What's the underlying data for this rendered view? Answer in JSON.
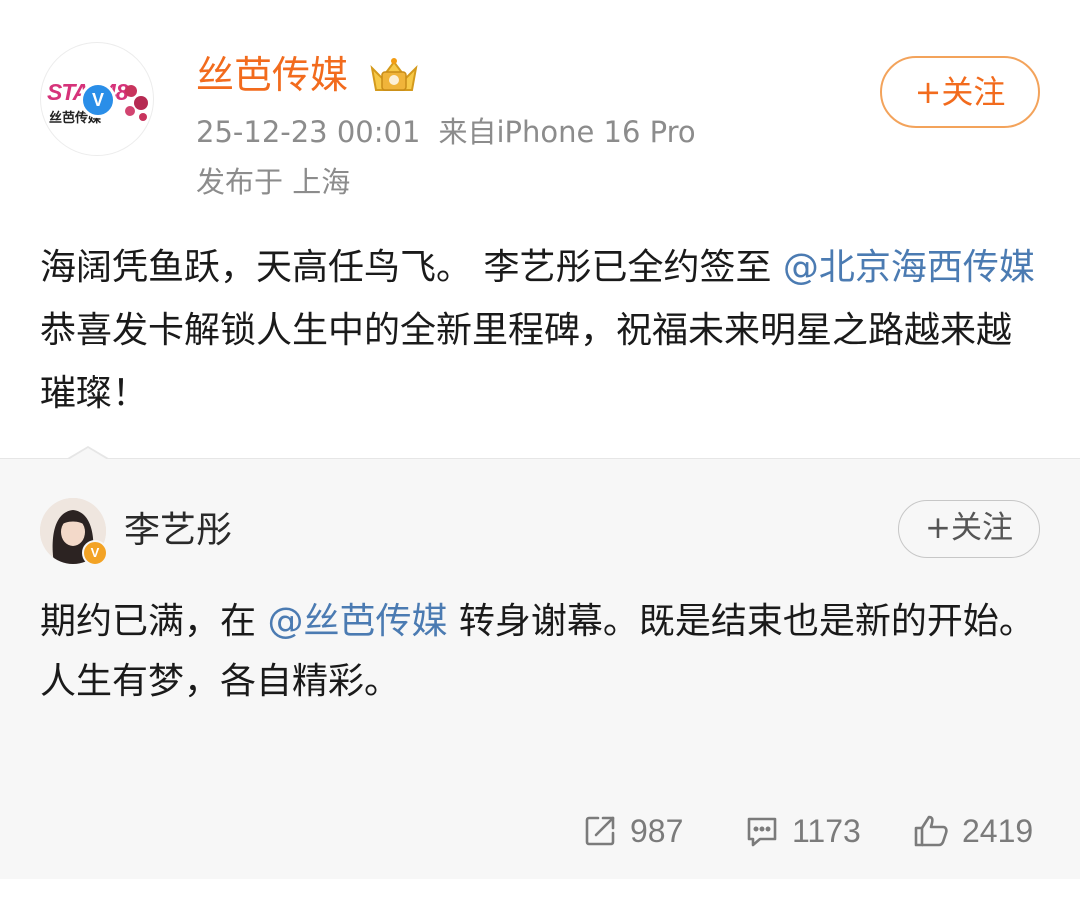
{
  "post": {
    "author": "丝芭传媒",
    "avatar_logo_text": "STAR48",
    "avatar_logo_cn": "丝芭传媒",
    "verified_mark": "V",
    "meta_time": "25-12-23 00:01",
    "meta_source": "来自iPhone 16 Pro",
    "meta_location": "发布于 上海",
    "follow_label": "+关注",
    "text_part1": "海阔凭鱼跃，天高任鸟飞。 李艺彤已全约签至 ",
    "mention": "@北京海西传媒",
    "text_part2": " 恭喜发卡解锁人生中的全新里程碑，祝福未来明星之路越来越璀璨！"
  },
  "repost": {
    "author": "李艺彤",
    "verified_mark": "V",
    "follow_label": "+关注",
    "line1_prefix": "期约已满，在 ",
    "line1_mention": "@丝芭传媒",
    "line1_suffix": " 转身谢幕。既是结束也是新的开始。",
    "line2": "人生有梦，各自精彩。"
  },
  "actions": {
    "repost_count": "987",
    "comment_count": "1173",
    "like_count": "2419"
  },
  "icons": {
    "repost": "share-arrow-icon",
    "comment": "comment-bubble-icon",
    "like": "thumbs-up-icon",
    "crown": "crown-badge-icon"
  },
  "colors": {
    "author_orange": "#f26b1d",
    "mention_blue": "#4b7bb2",
    "meta_gray": "#8c8c8c",
    "verified_blue": "#2a8ee8",
    "repost_bg": "#f7f7f7"
  }
}
